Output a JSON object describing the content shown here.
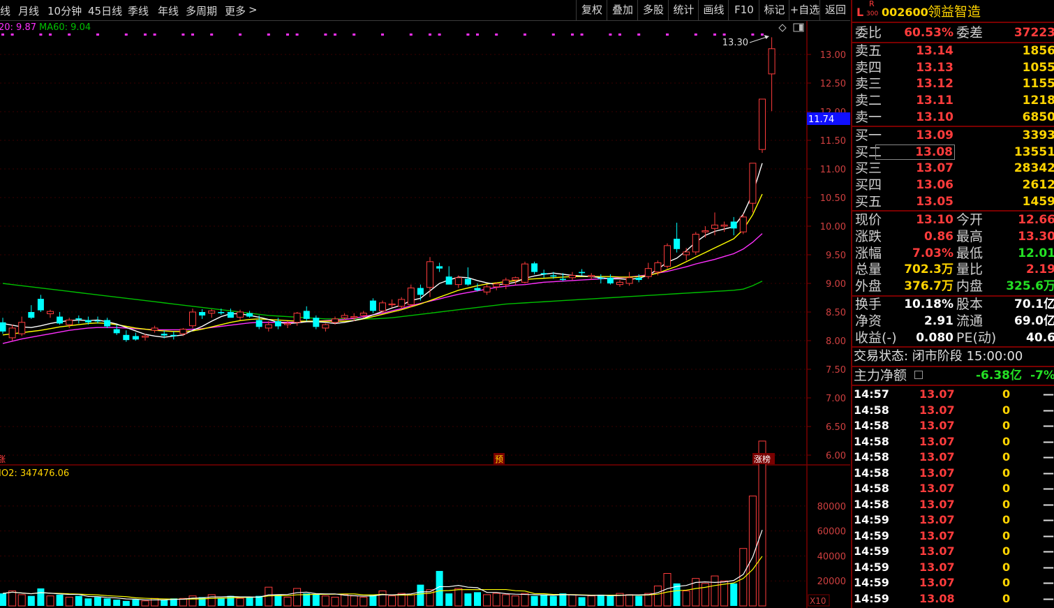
{
  "toolbar": {
    "left_items": [
      "线",
      "月线",
      "10分钟",
      "45日线",
      "季线",
      "年线",
      "多周期",
      "更多"
    ],
    "more_chevron": ">",
    "right_items": [
      "复权",
      "叠加",
      "多股",
      "统计",
      "画线",
      "F10",
      "标记",
      "+自选",
      "返回"
    ]
  },
  "chart_header": {
    "ma20_label": "20: 9.87",
    "ma60_label": "MA60: 9.04",
    "high_annotation": "13.30",
    "current_price_tag": "11.74",
    "marker_pre": "预",
    "marker_rank": "涨榜",
    "left_marker": "涨",
    "volume_label": "IO2: 347476.06",
    "volume_multiplier": "X10",
    "colors": {
      "ma5": "#ffffff",
      "ma10": "#ffff00",
      "ma20": "#ff30ff",
      "ma60": "#00c000",
      "up": "#ff3c3c",
      "down": "#00ffff"
    }
  },
  "price_axis": [
    "13.00",
    "12.50",
    "12.00",
    "11.50",
    "11.00",
    "10.50",
    "10.00",
    "9.50",
    "9.00",
    "8.50",
    "8.00",
    "7.50",
    "7.00",
    "6.50",
    "6.00"
  ],
  "volume_axis": [
    "80000",
    "60000",
    "40000",
    "20000"
  ],
  "chart_data": {
    "type": "candlestick",
    "price_range": [
      6.0,
      13.3
    ],
    "volume_range": [
      0,
      90000
    ],
    "candles": [
      {
        "o": 8.32,
        "h": 8.4,
        "l": 8.12,
        "c": 8.16
      },
      {
        "o": 8.05,
        "h": 8.28,
        "l": 8.0,
        "c": 8.22
      },
      {
        "o": 8.12,
        "h": 8.42,
        "l": 8.08,
        "c": 8.32
      },
      {
        "o": 8.5,
        "h": 8.62,
        "l": 8.38,
        "c": 8.4
      },
      {
        "o": 8.73,
        "h": 8.8,
        "l": 8.5,
        "c": 8.53
      },
      {
        "o": 8.47,
        "h": 8.54,
        "l": 8.4,
        "c": 8.51
      },
      {
        "o": 8.42,
        "h": 8.5,
        "l": 8.28,
        "c": 8.3
      },
      {
        "o": 8.28,
        "h": 8.4,
        "l": 8.22,
        "c": 8.36
      },
      {
        "o": 8.39,
        "h": 8.44,
        "l": 8.3,
        "c": 8.37
      },
      {
        "o": 8.36,
        "h": 8.42,
        "l": 8.28,
        "c": 8.32
      },
      {
        "o": 8.35,
        "h": 8.42,
        "l": 8.3,
        "c": 8.34
      },
      {
        "o": 8.36,
        "h": 8.4,
        "l": 8.22,
        "c": 8.25
      },
      {
        "o": 8.2,
        "h": 8.28,
        "l": 8.1,
        "c": 8.13
      },
      {
        "o": 8.1,
        "h": 8.18,
        "l": 7.98,
        "c": 8.01
      },
      {
        "o": 8.08,
        "h": 8.14,
        "l": 8.0,
        "c": 8.02
      },
      {
        "o": 8.06,
        "h": 8.12,
        "l": 8.0,
        "c": 8.08
      },
      {
        "o": 8.18,
        "h": 8.26,
        "l": 8.14,
        "c": 8.22
      },
      {
        "o": 8.12,
        "h": 8.18,
        "l": 8.04,
        "c": 8.09
      },
      {
        "o": 8.1,
        "h": 8.16,
        "l": 8.02,
        "c": 8.08
      },
      {
        "o": 8.12,
        "h": 8.22,
        "l": 8.08,
        "c": 8.2
      },
      {
        "o": 8.26,
        "h": 8.56,
        "l": 8.22,
        "c": 8.5
      },
      {
        "o": 8.5,
        "h": 8.55,
        "l": 8.38,
        "c": 8.44
      },
      {
        "o": 8.48,
        "h": 8.55,
        "l": 8.4,
        "c": 8.52
      },
      {
        "o": 8.5,
        "h": 8.56,
        "l": 8.45,
        "c": 8.48
      },
      {
        "o": 8.5,
        "h": 8.56,
        "l": 8.44,
        "c": 8.4
      },
      {
        "o": 8.41,
        "h": 8.54,
        "l": 8.36,
        "c": 8.5
      },
      {
        "o": 8.48,
        "h": 8.52,
        "l": 8.4,
        "c": 8.42
      },
      {
        "o": 8.36,
        "h": 8.44,
        "l": 8.2,
        "c": 8.24
      },
      {
        "o": 8.22,
        "h": 8.34,
        "l": 8.16,
        "c": 8.28
      },
      {
        "o": 8.34,
        "h": 8.4,
        "l": 8.2,
        "c": 8.25
      },
      {
        "o": 8.28,
        "h": 8.34,
        "l": 8.22,
        "c": 8.3
      },
      {
        "o": 8.32,
        "h": 8.5,
        "l": 8.26,
        "c": 8.48
      },
      {
        "o": 8.52,
        "h": 8.6,
        "l": 8.34,
        "c": 8.38
      },
      {
        "o": 8.4,
        "h": 8.44,
        "l": 8.2,
        "c": 8.24
      },
      {
        "o": 8.22,
        "h": 8.3,
        "l": 8.16,
        "c": 8.28
      },
      {
        "o": 8.32,
        "h": 8.42,
        "l": 8.28,
        "c": 8.38
      },
      {
        "o": 8.4,
        "h": 8.48,
        "l": 8.36,
        "c": 8.44
      },
      {
        "o": 8.4,
        "h": 8.48,
        "l": 8.34,
        "c": 8.42
      },
      {
        "o": 8.44,
        "h": 8.52,
        "l": 8.4,
        "c": 8.48
      },
      {
        "o": 8.7,
        "h": 8.74,
        "l": 8.48,
        "c": 8.52
      },
      {
        "o": 8.52,
        "h": 8.7,
        "l": 8.48,
        "c": 8.66
      },
      {
        "o": 8.64,
        "h": 8.72,
        "l": 8.58,
        "c": 8.64
      },
      {
        "o": 8.6,
        "h": 8.76,
        "l": 8.56,
        "c": 8.72
      },
      {
        "o": 8.63,
        "h": 8.98,
        "l": 8.58,
        "c": 8.92
      },
      {
        "o": 8.92,
        "h": 8.98,
        "l": 8.7,
        "c": 8.8
      },
      {
        "o": 8.93,
        "h": 9.46,
        "l": 8.76,
        "c": 9.38
      },
      {
        "o": 9.3,
        "h": 9.36,
        "l": 9.2,
        "c": 9.26
      },
      {
        "o": 9.12,
        "h": 9.3,
        "l": 9.08,
        "c": 8.98
      },
      {
        "o": 8.98,
        "h": 9.14,
        "l": 8.92,
        "c": 9.1
      },
      {
        "o": 9.08,
        "h": 9.28,
        "l": 8.96,
        "c": 8.98
      },
      {
        "o": 8.92,
        "h": 9.0,
        "l": 8.86,
        "c": 8.88
      },
      {
        "o": 8.85,
        "h": 8.98,
        "l": 8.8,
        "c": 8.94
      },
      {
        "o": 8.94,
        "h": 9.02,
        "l": 8.88,
        "c": 8.99
      },
      {
        "o": 8.98,
        "h": 9.1,
        "l": 8.9,
        "c": 9.06
      },
      {
        "o": 9.06,
        "h": 9.12,
        "l": 8.98,
        "c": 9.1
      },
      {
        "o": 9.02,
        "h": 9.38,
        "l": 9.0,
        "c": 9.34
      },
      {
        "o": 9.35,
        "h": 9.38,
        "l": 9.16,
        "c": 9.2
      },
      {
        "o": 9.18,
        "h": 9.24,
        "l": 9.1,
        "c": 9.16
      },
      {
        "o": 9.14,
        "h": 9.2,
        "l": 9.08,
        "c": 9.12
      },
      {
        "o": 9.08,
        "h": 9.18,
        "l": 9.04,
        "c": 9.06
      },
      {
        "o": 9.1,
        "h": 9.2,
        "l": 9.06,
        "c": 9.14
      },
      {
        "o": 9.2,
        "h": 9.25,
        "l": 9.14,
        "c": 9.18
      },
      {
        "o": 9.12,
        "h": 9.18,
        "l": 9.06,
        "c": 9.14
      },
      {
        "o": 9.1,
        "h": 9.16,
        "l": 9.0,
        "c": 9.08
      },
      {
        "o": 9.1,
        "h": 9.16,
        "l": 8.98,
        "c": 9.0
      },
      {
        "o": 8.98,
        "h": 9.06,
        "l": 8.94,
        "c": 9.02
      },
      {
        "o": 9.0,
        "h": 9.2,
        "l": 8.96,
        "c": 9.1
      },
      {
        "o": 9.1,
        "h": 9.16,
        "l": 9.02,
        "c": 9.06
      },
      {
        "o": 9.12,
        "h": 9.36,
        "l": 9.08,
        "c": 9.26
      },
      {
        "o": 9.2,
        "h": 9.4,
        "l": 9.14,
        "c": 9.36
      },
      {
        "o": 9.3,
        "h": 9.7,
        "l": 9.26,
        "c": 9.66
      },
      {
        "o": 9.78,
        "h": 10.06,
        "l": 9.54,
        "c": 9.6
      },
      {
        "o": 9.5,
        "h": 9.62,
        "l": 9.4,
        "c": 9.55
      },
      {
        "o": 9.55,
        "h": 9.9,
        "l": 9.5,
        "c": 9.86
      },
      {
        "o": 9.9,
        "h": 10.0,
        "l": 9.8,
        "c": 9.92
      },
      {
        "o": 9.96,
        "h": 10.24,
        "l": 9.84,
        "c": 10.02
      },
      {
        "o": 10.0,
        "h": 10.08,
        "l": 9.9,
        "c": 10.02
      },
      {
        "o": 10.08,
        "h": 10.16,
        "l": 9.84,
        "c": 9.96
      },
      {
        "o": 9.9,
        "h": 10.22,
        "l": 9.86,
        "c": 10.16
      },
      {
        "o": 10.4,
        "h": 10.52,
        "l": 10.24,
        "c": 11.1
      },
      {
        "o": 11.34,
        "h": 12.22,
        "l": 11.28,
        "c": 12.22
      },
      {
        "o": 12.66,
        "h": 13.3,
        "l": 12.01,
        "c": 13.1
      }
    ],
    "ma5": [
      8.3,
      8.27,
      8.24,
      8.23,
      8.26,
      8.3,
      8.33,
      8.35,
      8.36,
      8.35,
      8.36,
      8.33,
      8.29,
      8.23,
      8.17,
      8.11,
      8.08,
      8.06,
      8.08,
      8.1,
      8.18,
      8.25,
      8.34,
      8.42,
      8.47,
      8.47,
      8.44,
      8.41,
      8.37,
      8.32,
      8.3,
      8.31,
      8.33,
      8.33,
      8.32,
      8.3,
      8.32,
      8.35,
      8.39,
      8.45,
      8.51,
      8.57,
      8.62,
      8.7,
      8.74,
      8.87,
      9.0,
      9.06,
      9.11,
      9.1,
      9.05,
      9.01,
      8.98,
      8.99,
      9.02,
      9.09,
      9.13,
      9.16,
      9.18,
      9.16,
      9.14,
      9.13,
      9.12,
      9.1,
      9.08,
      9.08,
      9.07,
      9.09,
      9.14,
      9.25,
      9.37,
      9.44,
      9.57,
      9.72,
      9.84,
      9.91,
      9.95,
      9.99,
      10.21,
      10.57,
      11.1
    ],
    "ma10": [
      8.1,
      8.12,
      8.14,
      8.16,
      8.18,
      8.21,
      8.24,
      8.26,
      8.28,
      8.3,
      8.31,
      8.3,
      8.28,
      8.25,
      8.22,
      8.2,
      8.18,
      8.17,
      8.16,
      8.16,
      8.17,
      8.2,
      8.24,
      8.28,
      8.32,
      8.35,
      8.37,
      8.38,
      8.37,
      8.36,
      8.35,
      8.34,
      8.34,
      8.34,
      8.34,
      8.34,
      8.34,
      8.35,
      8.38,
      8.42,
      8.46,
      8.5,
      8.54,
      8.59,
      8.64,
      8.7,
      8.76,
      8.82,
      8.88,
      8.92,
      8.96,
      8.99,
      9.01,
      9.03,
      9.05,
      9.07,
      9.08,
      9.09,
      9.1,
      9.11,
      9.12,
      9.12,
      9.12,
      9.12,
      9.12,
      9.11,
      9.11,
      9.12,
      9.14,
      9.18,
      9.24,
      9.3,
      9.38,
      9.46,
      9.54,
      9.62,
      9.7,
      9.78,
      9.94,
      10.2,
      10.56
    ],
    "ma20": [
      7.95,
      7.99,
      8.03,
      8.06,
      8.09,
      8.12,
      8.15,
      8.18,
      8.2,
      8.22,
      8.23,
      8.23,
      8.23,
      8.22,
      8.21,
      8.2,
      8.19,
      8.19,
      8.19,
      8.19,
      8.2,
      8.21,
      8.23,
      8.25,
      8.27,
      8.29,
      8.31,
      8.32,
      8.32,
      8.32,
      8.32,
      8.32,
      8.33,
      8.34,
      8.35,
      8.36,
      8.37,
      8.39,
      8.42,
      8.45,
      8.48,
      8.52,
      8.56,
      8.61,
      8.65,
      8.69,
      8.73,
      8.77,
      8.81,
      8.84,
      8.87,
      8.9,
      8.93,
      8.95,
      8.97,
      8.98,
      9.0,
      9.02,
      9.03,
      9.04,
      9.05,
      9.06,
      9.07,
      9.08,
      9.09,
      9.1,
      9.11,
      9.13,
      9.15,
      9.18,
      9.21,
      9.25,
      9.29,
      9.34,
      9.38,
      9.42,
      9.47,
      9.52,
      9.6,
      9.72,
      9.87
    ],
    "ma60": [
      9.0,
      8.98,
      8.96,
      8.94,
      8.92,
      8.9,
      8.88,
      8.86,
      8.84,
      8.82,
      8.8,
      8.78,
      8.76,
      8.74,
      8.72,
      8.7,
      8.68,
      8.66,
      8.64,
      8.62,
      8.6,
      8.58,
      8.56,
      8.54,
      8.52,
      8.5,
      8.48,
      8.46,
      8.44,
      8.43,
      8.42,
      8.41,
      8.4,
      8.39,
      8.38,
      8.38,
      8.38,
      8.38,
      8.38,
      8.38,
      8.39,
      8.4,
      8.42,
      8.44,
      8.46,
      8.48,
      8.5,
      8.52,
      8.54,
      8.56,
      8.58,
      8.6,
      8.62,
      8.64,
      8.65,
      8.66,
      8.67,
      8.68,
      8.69,
      8.7,
      8.71,
      8.72,
      8.73,
      8.74,
      8.75,
      8.76,
      8.77,
      8.78,
      8.79,
      8.8,
      8.81,
      8.82,
      8.83,
      8.84,
      8.85,
      8.86,
      8.87,
      8.88,
      8.9,
      8.96,
      9.04
    ],
    "volumes": [
      10,
      12,
      9,
      8,
      14,
      8,
      9,
      7,
      8,
      6,
      7,
      6,
      5,
      4,
      5,
      4,
      6,
      5,
      6,
      6,
      8,
      7,
      9,
      6,
      8,
      6,
      7,
      8,
      15,
      9,
      7,
      14,
      10,
      9,
      8,
      7,
      9,
      8,
      7,
      9,
      12,
      8,
      10,
      9,
      17,
      13,
      28,
      10,
      14,
      10,
      11,
      9,
      10,
      9,
      8,
      10,
      8,
      9,
      8,
      10,
      9,
      7,
      8,
      9,
      8,
      10,
      9,
      8,
      10,
      16,
      26,
      18,
      12,
      22,
      18,
      24,
      20,
      18,
      46,
      88,
      132
    ]
  },
  "panel": {
    "prefix": "L",
    "badge_top": "R",
    "badge_bottom": "300",
    "code": "002600",
    "name": "领益智造",
    "weibi": {
      "label": "委比",
      "value": "60.53%",
      "label2": "委差",
      "value2": "37223"
    },
    "sells": [
      {
        "label": "卖五",
        "price": "13.14",
        "vol": "1856"
      },
      {
        "label": "卖四",
        "price": "13.13",
        "vol": "1055"
      },
      {
        "label": "卖三",
        "price": "13.12",
        "vol": "1155"
      },
      {
        "label": "卖二",
        "price": "13.11",
        "vol": "1218"
      },
      {
        "label": "卖一",
        "price": "13.10",
        "vol": "6850"
      }
    ],
    "buys": [
      {
        "label": "买一",
        "price": "13.09",
        "vol": "3393"
      },
      {
        "label": "买二",
        "price": "13.08",
        "vol": "13551"
      },
      {
        "label": "买三",
        "price": "13.07",
        "vol": "28342"
      },
      {
        "label": "买四",
        "price": "13.06",
        "vol": "2612"
      },
      {
        "label": "买五",
        "price": "13.05",
        "vol": "1459"
      }
    ],
    "stats1": [
      {
        "l1": "现价",
        "v1": "13.10",
        "l2": "今开",
        "v2": "12.66",
        "c2": "red"
      },
      {
        "l1": "涨跌",
        "v1": "0.86",
        "l2": "最高",
        "v2": "13.30",
        "c2": "red"
      },
      {
        "l1": "涨幅",
        "v1": "7.03%",
        "l2": "最低",
        "v2": "12.01",
        "c2": "grn"
      },
      {
        "l1": "总量",
        "v1": "702.3万",
        "l2": "量比",
        "v2": "2.19",
        "c2": "red"
      },
      {
        "l1": "外盘",
        "v1": "376.7万",
        "l2": "内盘",
        "v2": "325.6万",
        "c2": "grn"
      }
    ],
    "stats2": [
      {
        "l1": "换手",
        "v1": "10.18%",
        "l2": "股本",
        "v2": "70.1亿"
      },
      {
        "l1": "净资",
        "v1": "2.91",
        "l2": "流通",
        "v2": "69.0亿"
      },
      {
        "l1": "收益(-)",
        "v1": "0.080",
        "l2": "PE(动)",
        "v2": "40.6"
      }
    ],
    "trade_status": "交易状态: 闭市阶段 15:00:00",
    "main_net": {
      "label": "主力净额",
      "value": "-6.38亿",
      "pct": "-7%"
    },
    "ticks": [
      {
        "time": "14:57",
        "price": "13.07",
        "vol": "0",
        "dir": "—"
      },
      {
        "time": "14:58",
        "price": "13.07",
        "vol": "0",
        "dir": "—"
      },
      {
        "time": "14:58",
        "price": "13.07",
        "vol": "0",
        "dir": "—"
      },
      {
        "time": "14:58",
        "price": "13.07",
        "vol": "0",
        "dir": "—"
      },
      {
        "time": "14:58",
        "price": "13.07",
        "vol": "0",
        "dir": "—"
      },
      {
        "time": "14:58",
        "price": "13.07",
        "vol": "0",
        "dir": "—"
      },
      {
        "time": "14:58",
        "price": "13.07",
        "vol": "0",
        "dir": "—"
      },
      {
        "time": "14:58",
        "price": "13.07",
        "vol": "0",
        "dir": "—"
      },
      {
        "time": "14:59",
        "price": "13.07",
        "vol": "0",
        "dir": "—"
      },
      {
        "time": "14:59",
        "price": "13.07",
        "vol": "0",
        "dir": "—"
      },
      {
        "time": "14:59",
        "price": "13.07",
        "vol": "0",
        "dir": "—"
      },
      {
        "time": "14:59",
        "price": "13.07",
        "vol": "0",
        "dir": "—"
      },
      {
        "time": "14:59",
        "price": "13.07",
        "vol": "0",
        "dir": "—"
      },
      {
        "time": "14:59",
        "price": "13.08",
        "vol": "0",
        "dir": "—"
      }
    ]
  }
}
